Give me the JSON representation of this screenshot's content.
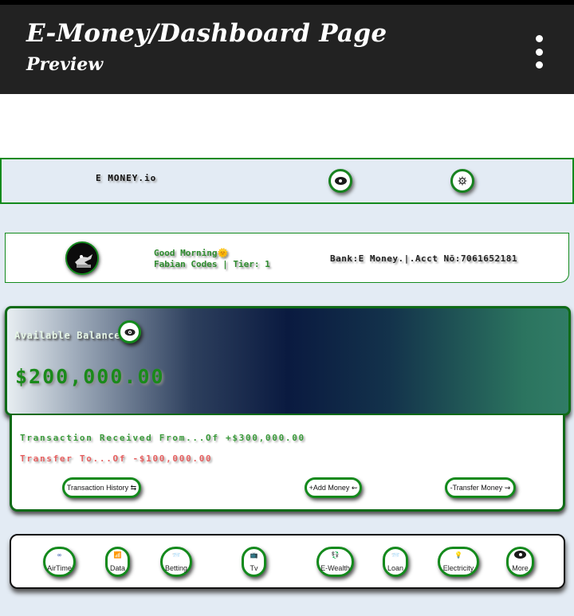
{
  "appbar": {
    "title": "E-Money/Dashboard Page",
    "subtitle": "Preview"
  },
  "navbar": {
    "brand": "E MONEY.io"
  },
  "user": {
    "greeting": "Good Morning🌞",
    "name_tier": "Fabian Codes | Tier: 1",
    "bank_account": "Bank:E Money.|.Acct Nō:7061652181"
  },
  "balance": {
    "label": "Available Balance",
    "amount": "$200,000.00"
  },
  "transactions": {
    "received": "Transaction Received From...Of +$300,000.00",
    "transfer": "Transfer To...Of -$100,000.00"
  },
  "actions": {
    "history": "Transaction History ⇆",
    "add_money": "+Add Money ⇜",
    "transfer_money": "-Transfer Money ⇝"
  },
  "services": [
    {
      "label": "AirTime",
      "icon": "∞"
    },
    {
      "label": "Data",
      "icon": "📶"
    },
    {
      "label": "Betting",
      "icon": "📨"
    },
    {
      "label": "Tv",
      "icon": "📺"
    },
    {
      "label": "E-Wealth",
      "icon": "💱"
    },
    {
      "label": "Loan",
      "icon": "📨"
    },
    {
      "label": "Electricity",
      "icon": "💡"
    },
    {
      "label": "More",
      "icon": "more-icon"
    }
  ],
  "colors": {
    "appbar": "#222222",
    "accent_green": "#138a1c",
    "page_bg": "#e3ebf4",
    "credit_text": "#3a9a3a",
    "debit_text": "#e66060"
  }
}
